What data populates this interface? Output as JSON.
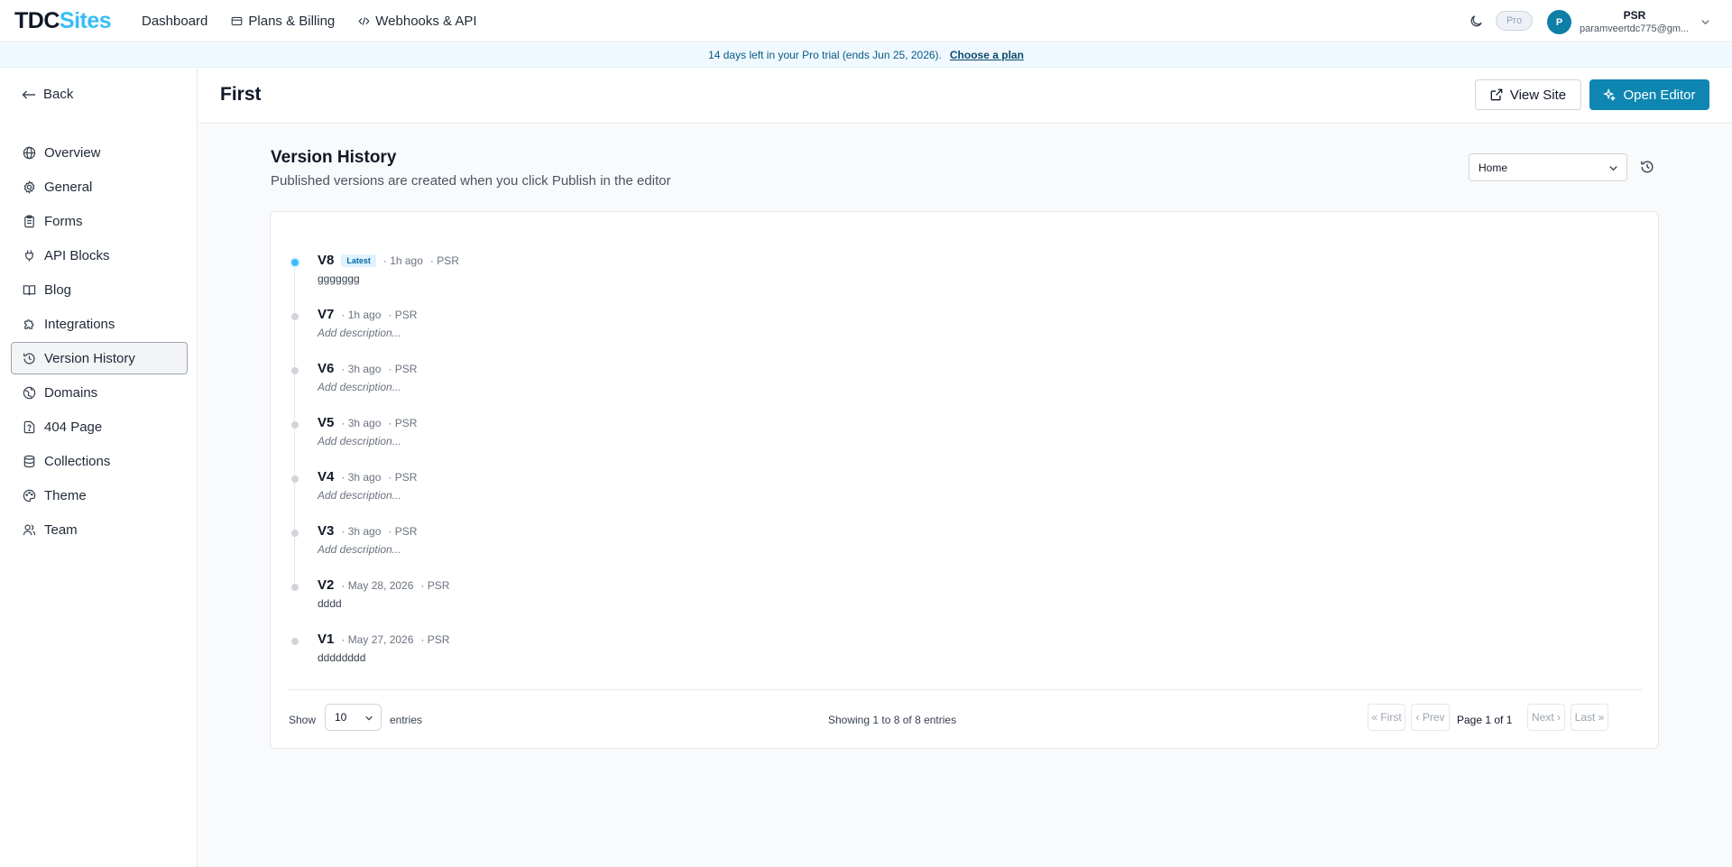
{
  "app": {
    "logo_part1": "TDC",
    "logo_part2": "Sites",
    "accent": "#38bdf8",
    "primary": "#0e86b1"
  },
  "nav": {
    "dashboard": "Dashboard",
    "billing": "Plans & Billing",
    "webhooks": "Webhooks & API"
  },
  "top_right": {
    "theme_icon": "moon-icon",
    "plan_badge": "Pro",
    "user": {
      "initial": "P",
      "name": "PSR",
      "email": "paramveertdc775@gm..."
    }
  },
  "banner": {
    "text": "14 days left in your Pro trial (ends Jun 25, 2026).",
    "cta": "Choose a plan"
  },
  "sidebar": {
    "back": "Back",
    "items": [
      {
        "label": "Overview",
        "icon": "globe-icon"
      },
      {
        "label": "General",
        "icon": "gear-icon"
      },
      {
        "label": "Forms",
        "icon": "clipboard-icon"
      },
      {
        "label": "API Blocks",
        "icon": "plug-icon"
      },
      {
        "label": "Blog",
        "icon": "book-icon"
      },
      {
        "label": "Integrations",
        "icon": "puzzle-icon"
      },
      {
        "label": "Version History",
        "icon": "history-icon",
        "active": true
      },
      {
        "label": "Domains",
        "icon": "globe-lines-icon"
      },
      {
        "label": "404 Page",
        "icon": "file-question-icon"
      },
      {
        "label": "Collections",
        "icon": "database-icon"
      },
      {
        "label": "Theme",
        "icon": "palette-icon"
      },
      {
        "label": "Team",
        "icon": "users-icon"
      }
    ]
  },
  "page": {
    "title": "First",
    "view_site": "View Site",
    "open_editor": "Open Editor"
  },
  "version_history": {
    "title": "Version History",
    "subtitle": "Published versions are created when you click Publish in the editor",
    "page_selected": "Home",
    "versions": [
      {
        "name": "V8",
        "badge": "Latest",
        "time": "· 1h ago",
        "author": "· PSR",
        "description": "ggggggg",
        "placeholder": false
      },
      {
        "name": "V7",
        "badge": "",
        "time": "· 1h ago",
        "author": "· PSR",
        "description": "Add description...",
        "placeholder": true
      },
      {
        "name": "V6",
        "badge": "",
        "time": "· 3h ago",
        "author": "· PSR",
        "description": "Add description...",
        "placeholder": true
      },
      {
        "name": "V5",
        "badge": "",
        "time": "· 3h ago",
        "author": "· PSR",
        "description": "Add description...",
        "placeholder": true
      },
      {
        "name": "V4",
        "badge": "",
        "time": "· 3h ago",
        "author": "· PSR",
        "description": "Add description...",
        "placeholder": true
      },
      {
        "name": "V3",
        "badge": "",
        "time": "· 3h ago",
        "author": "· PSR",
        "description": "Add description...",
        "placeholder": true
      },
      {
        "name": "V2",
        "badge": "",
        "time": "· May 28, 2026",
        "author": "· PSR",
        "description": "dddd",
        "placeholder": false
      },
      {
        "name": "V1",
        "badge": "",
        "time": "· May 27, 2026",
        "author": "· PSR",
        "description": "dddddddd",
        "placeholder": false
      }
    ],
    "footer": {
      "show": "Show",
      "per_page": "10",
      "entries": "entries",
      "showing": "Showing 1 to 8 of 8 entries",
      "first": "« First",
      "prev": "‹ Prev",
      "page_label": "Page 1 of 1",
      "next": "Next ›",
      "last": "Last »"
    }
  }
}
